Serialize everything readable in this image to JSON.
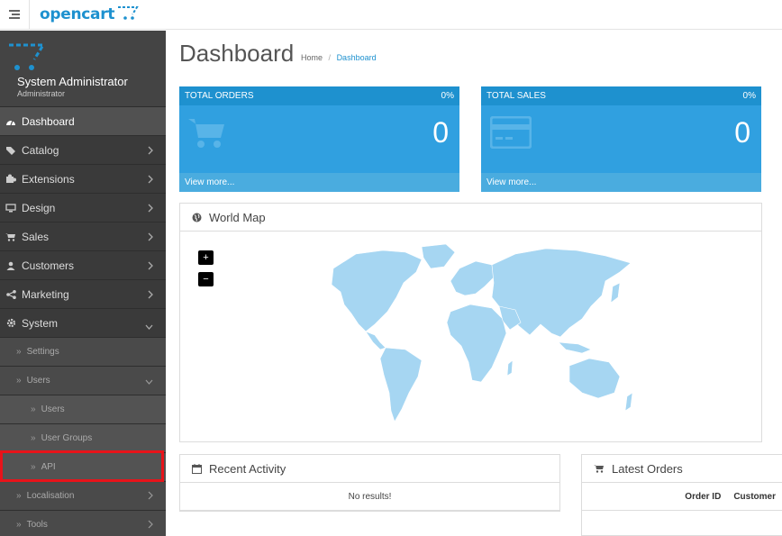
{
  "header": {
    "logo_text": "opencart",
    "menu_icon": "bars-icon"
  },
  "profile": {
    "name": "System Administrator",
    "role": "Administrator"
  },
  "nav": {
    "dashboard": "Dashboard",
    "catalog": "Catalog",
    "extensions": "Extensions",
    "design": "Design",
    "sales": "Sales",
    "customers": "Customers",
    "marketing": "Marketing",
    "system": "System",
    "settings": "Settings",
    "users": "Users",
    "users_sub": "Users",
    "user_groups": "User Groups",
    "api": "API",
    "localisation": "Localisation",
    "tools": "Tools"
  },
  "page": {
    "title": "Dashboard",
    "crumb_home": "Home",
    "crumb_sep": "/",
    "crumb_current": "Dashboard"
  },
  "tiles": {
    "orders": {
      "title": "TOTAL ORDERS",
      "pct": "0%",
      "value": "0",
      "link": "View more..."
    },
    "sales": {
      "title": "TOTAL SALES",
      "pct": "0%",
      "value": "0",
      "link": "View more..."
    }
  },
  "map": {
    "title": "World Map",
    "zoom_in": "+",
    "zoom_out": "−"
  },
  "activity": {
    "title": "Recent Activity",
    "empty": "No results!"
  },
  "orders_panel": {
    "title": "Latest Orders",
    "col_order_id": "Order ID",
    "col_customer": "Customer"
  },
  "colors": {
    "accent": "#1e91cf",
    "tile": "#30a0e0",
    "sidebar": "#3a3a3a",
    "highlight": "#e8131a",
    "map_land": "#a6d6f2"
  }
}
